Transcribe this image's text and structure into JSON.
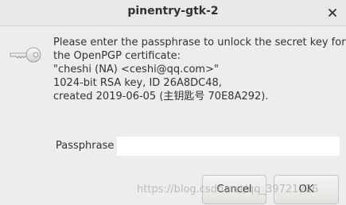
{
  "window": {
    "title": "pinentry-gtk-2"
  },
  "icons": {
    "close": "close-icon",
    "key": "key-icon"
  },
  "message": {
    "lines": [
      "Please enter the passphrase to unlock the secret key for",
      "the OpenPGP certificate:",
      "\"cheshi (NA) <ceshi@qq.com>\"",
      "1024-bit RSA key, ID 26A8DC48,",
      "created 2019-06-05 (主钥匙号 70E8A292)."
    ]
  },
  "passphrase": {
    "label": "Passphrase",
    "value": ""
  },
  "buttons": {
    "cancel_label": "Cancel",
    "ok_label": "OK"
  },
  "watermark": {
    "text": "https://blog.csdn.net/qq_39721226"
  },
  "colors": {
    "background": "#ededed",
    "titlebar": "#e8e8e7",
    "text": "#2e3436"
  }
}
